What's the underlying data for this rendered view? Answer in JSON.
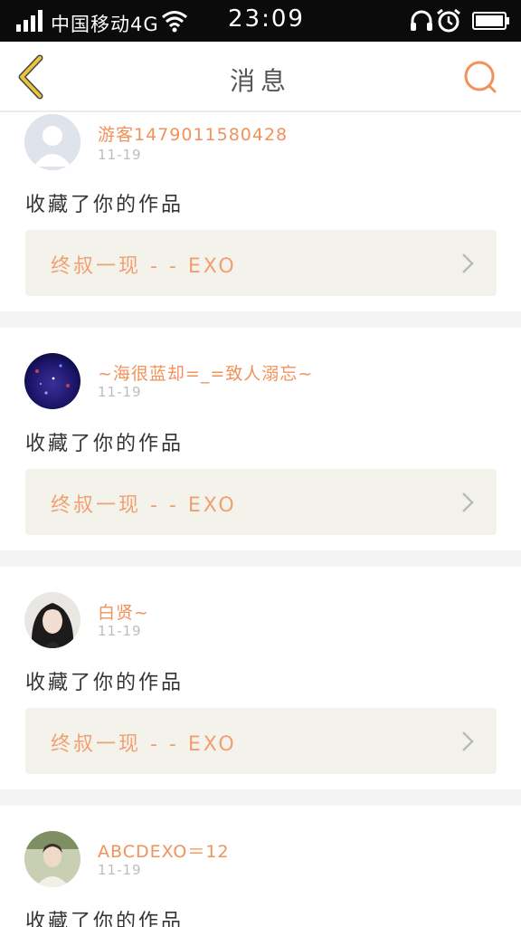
{
  "status_bar": {
    "carrier": "中国移动4G",
    "time": "23:09",
    "icons": [
      "signal-icon",
      "wifi-icon",
      "headset-icon",
      "alarm-icon",
      "battery-icon"
    ]
  },
  "nav": {
    "title": "消息",
    "back_icon": "chevron-left-icon",
    "search_icon": "search-icon",
    "accent_color": "#f2925a",
    "back_color": "#e8c53a"
  },
  "messages": [
    {
      "username": "游客1479011580428",
      "date": "11-19",
      "action": "收藏了你的作品",
      "work_title": "终叔一现 - - EXO",
      "avatar": "default-avatar"
    },
    {
      "username": "~海很蓝却=_=致人溺忘~",
      "date": "11-19",
      "action": "收藏了你的作品",
      "work_title": "终叔一现 - - EXO",
      "avatar": "blue-stars-avatar"
    },
    {
      "username": "白贤~",
      "date": "11-19",
      "action": "收藏了你的作品",
      "work_title": "终叔一现 - - EXO",
      "avatar": "portrait-avatar"
    },
    {
      "username": "ABCDEXO＝12",
      "date": "11-19",
      "action": "收藏了你的作品",
      "work_title": "",
      "avatar": "photo-avatar"
    }
  ]
}
